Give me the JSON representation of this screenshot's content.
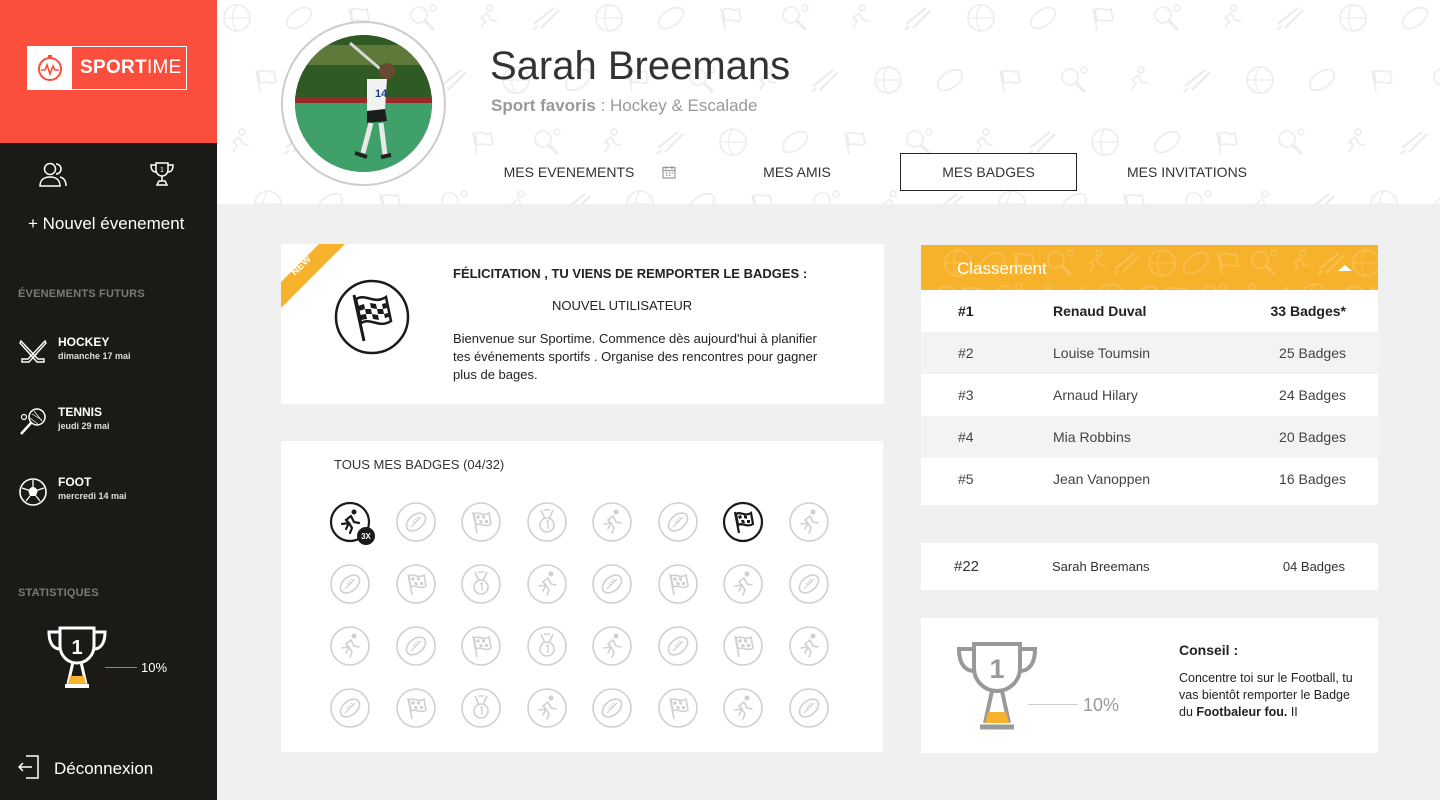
{
  "brand": {
    "name_bold": "SPORT",
    "name_light": "IME",
    "accent": "#fb4e3c",
    "gold": "#f7b22b",
    "sidebar_bg": "#1b1a16"
  },
  "sidebar": {
    "new_event": "+ Nouvel évenement",
    "future_heading": "ÉVENEMENTS FUTURS",
    "events": [
      {
        "sport": "HOCKEY",
        "date": "dimanche 17 mai",
        "icon": "hockey-sticks-icon"
      },
      {
        "sport": "TENNIS",
        "date": "jeudi 29 mai",
        "icon": "tennis-racket-icon"
      },
      {
        "sport": "FOOT",
        "date": "mercredi 14 mai",
        "icon": "soccer-ball-icon"
      }
    ],
    "stats_heading": "STATISTIQUES",
    "stats_percent": "10%",
    "stats_rank": "1",
    "logout": "Déconnexion"
  },
  "profile": {
    "name": "Sarah Breemans",
    "favorite_label": "Sport favoris",
    "favorite_value": " : Hockey & Escalade",
    "jersey": "14"
  },
  "tabs": [
    {
      "label": "MES EVENEMENTS",
      "active": false
    },
    {
      "label": "MES AMIS",
      "active": false
    },
    {
      "label": "MES BADGES",
      "active": true
    },
    {
      "label": "MES INVITATIONS",
      "active": false
    }
  ],
  "congrats": {
    "ribbon": "NEW",
    "title": "FÉLICITATION , TU VIENS DE REMPORTER LE BADGES :",
    "badge_name": "NOUVEL UTILISATEUR",
    "body": "Bienvenue sur Sportime.  Commence dès aujourd'hui à planifier tes événements sportifs . Organise des rencontres pour gagner plus de bages."
  },
  "badges": {
    "title": "TOUS MES BADGES  (04/32)",
    "multiplier": "3X",
    "rows": [
      [
        {
          "type": "runner",
          "earned": true
        },
        {
          "type": "rugby",
          "earned": false
        },
        {
          "type": "flag",
          "earned": false
        },
        {
          "type": "medal",
          "earned": false
        },
        {
          "type": "runner",
          "earned": false
        },
        {
          "type": "rugby",
          "earned": false
        },
        {
          "type": "flag",
          "earned": true
        },
        {
          "type": "runner",
          "earned": false
        }
      ],
      [
        {
          "type": "rugby",
          "earned": false
        },
        {
          "type": "flag",
          "earned": false
        },
        {
          "type": "medal",
          "earned": false
        },
        {
          "type": "runner",
          "earned": false
        },
        {
          "type": "rugby",
          "earned": false
        },
        {
          "type": "flag",
          "earned": false
        },
        {
          "type": "runner",
          "earned": false
        },
        {
          "type": "rugby",
          "earned": false
        }
      ],
      [
        {
          "type": "runner",
          "earned": false
        },
        {
          "type": "rugby",
          "earned": false
        },
        {
          "type": "flag",
          "earned": false
        },
        {
          "type": "medal",
          "earned": false
        },
        {
          "type": "runner",
          "earned": false
        },
        {
          "type": "rugby",
          "earned": false
        },
        {
          "type": "flag",
          "earned": false
        },
        {
          "type": "runner",
          "earned": false
        }
      ],
      [
        {
          "type": "rugby",
          "earned": false
        },
        {
          "type": "flag",
          "earned": false
        },
        {
          "type": "medal",
          "earned": false
        },
        {
          "type": "runner",
          "earned": false
        },
        {
          "type": "rugby",
          "earned": false
        },
        {
          "type": "flag",
          "earned": false
        },
        {
          "type": "runner",
          "earned": false
        },
        {
          "type": "rugby",
          "earned": false
        }
      ]
    ]
  },
  "ranking": {
    "title": "Classement",
    "rows": [
      {
        "pos": "#1",
        "name": "Renaud Duval",
        "badges": "33 Badges*"
      },
      {
        "pos": "#2",
        "name": "Louise Toumsin",
        "badges": "25 Badges"
      },
      {
        "pos": "#3",
        "name": "Arnaud Hilary",
        "badges": "24 Badges"
      },
      {
        "pos": "#4",
        "name": "Mia Robbins",
        "badges": "20 Badges"
      },
      {
        "pos": "#5",
        "name": "Jean Vanoppen",
        "badges": "16 Badges"
      }
    ],
    "me": {
      "pos": "#22",
      "name": "Sarah Breemans",
      "badges": "04 Badges"
    }
  },
  "advice": {
    "title": "Conseil :",
    "text_before": "Concentre toi sur le Football, tu vas bientôt remporter le Badge du ",
    "text_bold": "Footbaleur fou.",
    "text_after": " II",
    "percent": "10%",
    "rank": "1"
  }
}
